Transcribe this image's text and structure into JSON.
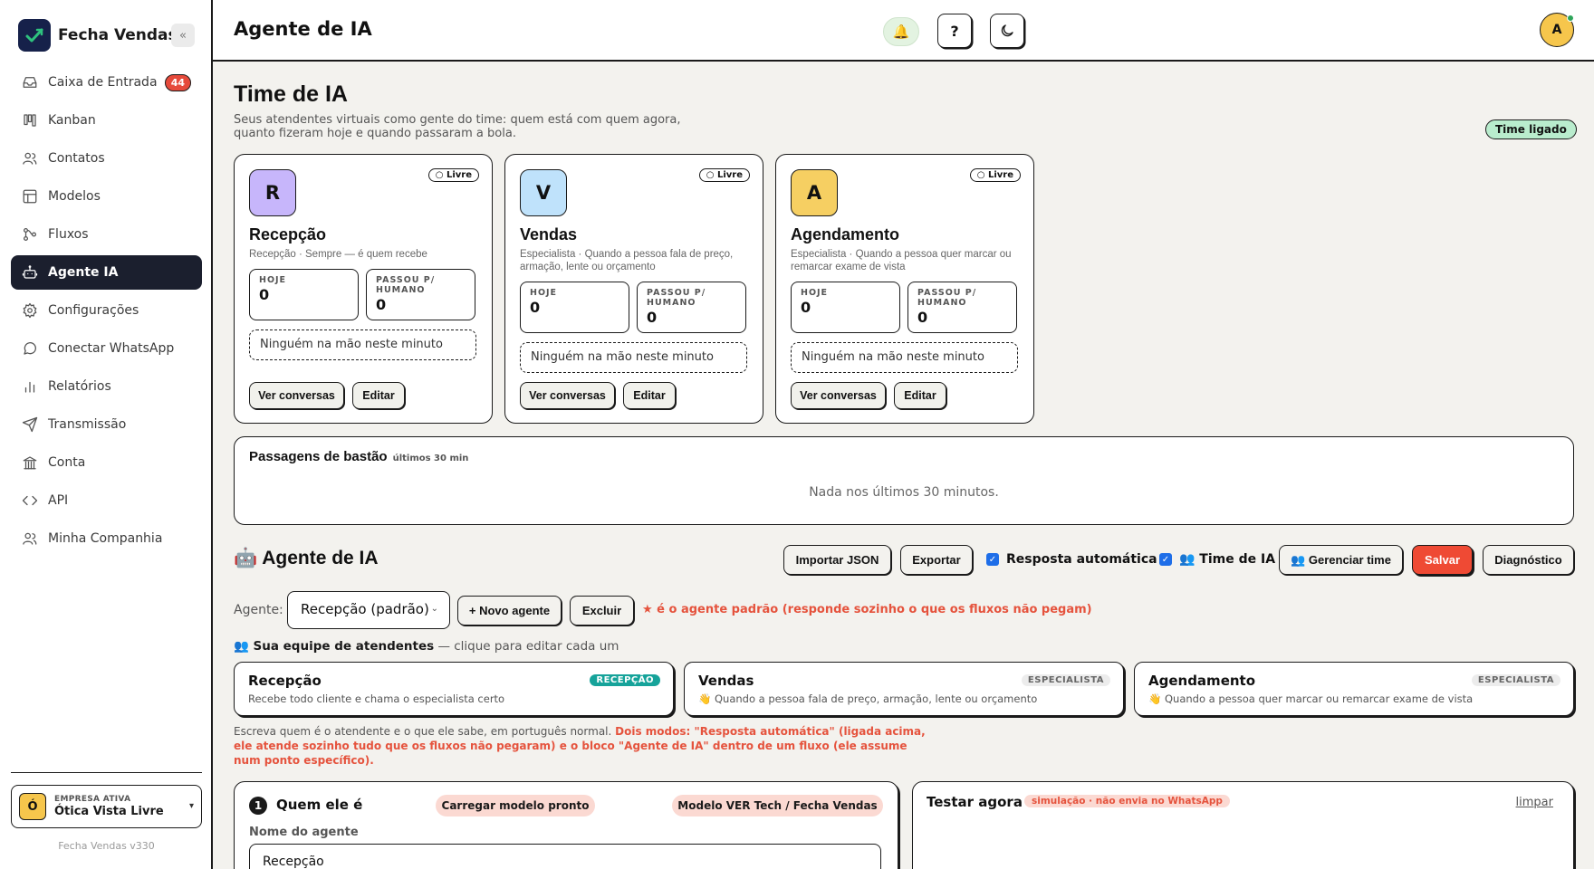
{
  "app": {
    "name": "Fecha Vendas",
    "collapse_icon": "«",
    "version": "Fecha Vendas v330"
  },
  "sidebar": {
    "items": [
      {
        "label": "Caixa de Entrada",
        "icon": "inbox-icon",
        "badge": "44"
      },
      {
        "label": "Kanban",
        "icon": "kanban-icon"
      },
      {
        "label": "Contatos",
        "icon": "contacts-icon"
      },
      {
        "label": "Modelos",
        "icon": "templates-icon"
      },
      {
        "label": "Fluxos",
        "icon": "flows-icon"
      },
      {
        "label": "Agente IA",
        "icon": "robot-icon",
        "active": true
      },
      {
        "label": "Configurações",
        "icon": "gear-icon"
      },
      {
        "label": "Conectar WhatsApp",
        "icon": "chat-icon"
      },
      {
        "label": "Relatórios",
        "icon": "bar-chart-icon"
      },
      {
        "label": "Transmissão",
        "icon": "send-icon"
      },
      {
        "label": "Conta",
        "icon": "bank-icon"
      },
      {
        "label": "API",
        "icon": "code-icon"
      },
      {
        "label": "Minha Companhia",
        "icon": "company-icon"
      }
    ],
    "company": {
      "label": "EMPRESA ATIVA",
      "name": "Ótica Vista Livre",
      "initial": "Ó",
      "caret": "▾"
    }
  },
  "header": {
    "title": "Agente de IA",
    "bell_icon": "🔔",
    "help_label": "?",
    "avatar_initial": "A"
  },
  "team": {
    "title": "Time de IA",
    "subtitle": "Seus atendentes virtuais como gente do time: quem está com quem agora, quanto fizeram hoje e quando passaram a bola.",
    "status_pill": "Time ligado",
    "stat_today_label": "HOJE",
    "stat_handoff_label": "PASSOU P/ HUMANO",
    "empty_label": "Ninguém na mão neste minuto",
    "view_label": "Ver conversas",
    "edit_label": "Editar",
    "cards": [
      {
        "initial": "R",
        "color": "#c7b6fb",
        "status": "○ Livre",
        "name": "Recepção",
        "desc": "Recepção · Sempre — é quem recebe",
        "today": "0",
        "handoff": "0"
      },
      {
        "initial": "V",
        "color": "#bfe2fb",
        "status": "○ Livre",
        "name": "Vendas",
        "desc": "Especialista · Quando a pessoa fala de preço, armação, lente ou orçamento",
        "today": "0",
        "handoff": "0"
      },
      {
        "initial": "A",
        "color": "#f6cf62",
        "status": "○ Livre",
        "name": "Agendamento",
        "desc": "Especialista · Quando a pessoa quer marcar ou remarcar exame de vista",
        "today": "0",
        "handoff": "0"
      }
    ]
  },
  "relay": {
    "title": "Passagens de bastão",
    "tag": "últimos 30 min",
    "empty": "Nada nos últimos 30 minutos."
  },
  "agent": {
    "title": "🤖 Agente de IA",
    "toolbar": {
      "import_label": "Importar JSON",
      "export_label": "Exportar",
      "auto_reply_label": "Resposta automática",
      "team_label": "👥 Time de IA",
      "manage_label": "👥 Gerenciar time",
      "save_label": "Salvar",
      "diag_label": "Diagnóstico",
      "check_mark": "✓"
    },
    "agent_label": "Agente:",
    "selected": "Recepção (padrão)",
    "caret": "⌄",
    "new_label": "+ Novo agente",
    "delete_label": "Excluir",
    "default_note": "★ é o agente padrão (responde sozinho o que os fluxos não pegam)",
    "team_head_bold": "👥 Sua equipe de atendentes",
    "team_head_rest": " — clique para editar cada um",
    "members": [
      {
        "name": "Recepção",
        "desc": "Recebe todo cliente e chama o especialista certo",
        "tag": "RECEPÇÃO",
        "tag_style": "green"
      },
      {
        "name": "Vendas",
        "desc": "👋 Quando a pessoa fala de preço, armação, lente ou orçamento",
        "tag": "ESPECIALISTA",
        "tag_style": "grey"
      },
      {
        "name": "Agendamento",
        "desc": "👋 Quando a pessoa quer marcar ou remarcar exame de vista",
        "tag": "ESPECIALISTA",
        "tag_style": "grey"
      }
    ],
    "help_plain": "Escreva quem é o atendente e o que ele sabe, em português normal. ",
    "help_bold": "Dois modos: \"Resposta automática\" (ligada acima, ele atende sozinho tudo que os fluxos não pegaram) e o bloco \"Agente de IA\" dentro de um fluxo (ele assume num ponto específico).",
    "step": {
      "number": "1",
      "title": "Quem ele é",
      "load_label": "Carregar modelo pronto",
      "model_label": "Modelo VER Tech / Fecha Vendas",
      "name_label": "Nome do agente",
      "name_value": "Recepção"
    },
    "test": {
      "title": "Testar agora",
      "tag": "simulação · não envia no WhatsApp",
      "clear_label": "limpar"
    }
  },
  "colors": {
    "accent_dark": "#1b1f2e",
    "save_red": "#ef4a34",
    "note_red": "#e5533d",
    "badge_red": "#e64a3b",
    "pill_green": "#b9eccd",
    "tag_teal": "#16a39a"
  }
}
